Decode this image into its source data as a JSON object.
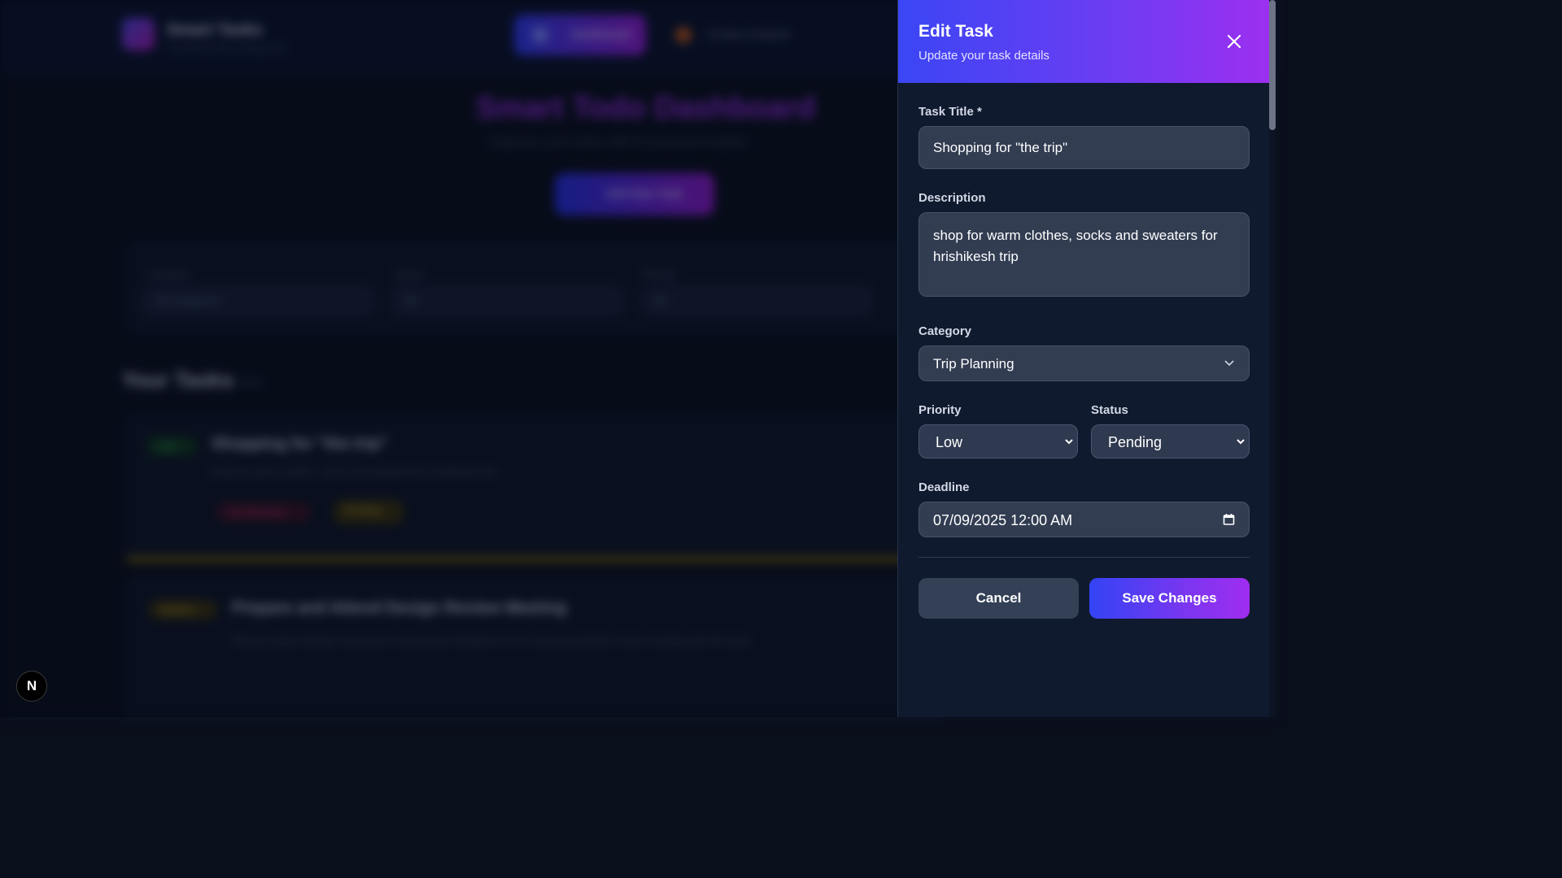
{
  "background": {
    "brand": "Smart Tasks",
    "brand_sub": "AI-powered task management",
    "nav_active": "Dashboard",
    "nav_second": "Create Analysis",
    "dashboard_title": "Smart Todo Dashboard",
    "dashboard_sub": "Organize your tasks with AI-powered insights",
    "add_button": "Add New Task",
    "filters": [
      {
        "label": "Category",
        "value": "All Categories"
      },
      {
        "label": "Status",
        "value": "All"
      },
      {
        "label": "Priority",
        "value": "All"
      }
    ],
    "tasks_heading": "Your Tasks",
    "tasks_count": "2 tasks",
    "card1_badge": "Low",
    "card1_title": "Shopping for \"the trip\"",
    "card1_desc": "shop for warm clothes, socks and sweaters for hrishikesh trip",
    "card1_cat": "Trip Planning",
    "card1_status": "Pending",
    "card2_badge": "Medium",
    "card2_title": "Prepare and Attend Design Review Meeting",
    "card2_desc": "Review project design documents and prepare feedback for the upcoming design review meeting with the team"
  },
  "next_badge": "N",
  "drawer": {
    "title": "Edit Task",
    "subtitle": "Update your task details",
    "close_icon": "close-icon",
    "fields": {
      "title_label": "Task Title *",
      "title_value": "Shopping for \"the trip\"",
      "description_label": "Description",
      "description_value": "shop for warm clothes, socks and sweaters for hrishikesh trip",
      "category_label": "Category",
      "category_value": "Trip Planning",
      "priority_label": "Priority",
      "priority_value": "Low",
      "status_label": "Status",
      "status_value": "Pending",
      "deadline_label": "Deadline",
      "deadline_value": "07/09/2025 12:00 AM"
    },
    "cancel_label": "Cancel",
    "save_label": "Save Changes"
  },
  "colors": {
    "header_gradient_start": "#3b46f4",
    "header_gradient_end": "#9d2ff0",
    "panel_bg": "#101a2e",
    "field_bg": "#323d52"
  }
}
